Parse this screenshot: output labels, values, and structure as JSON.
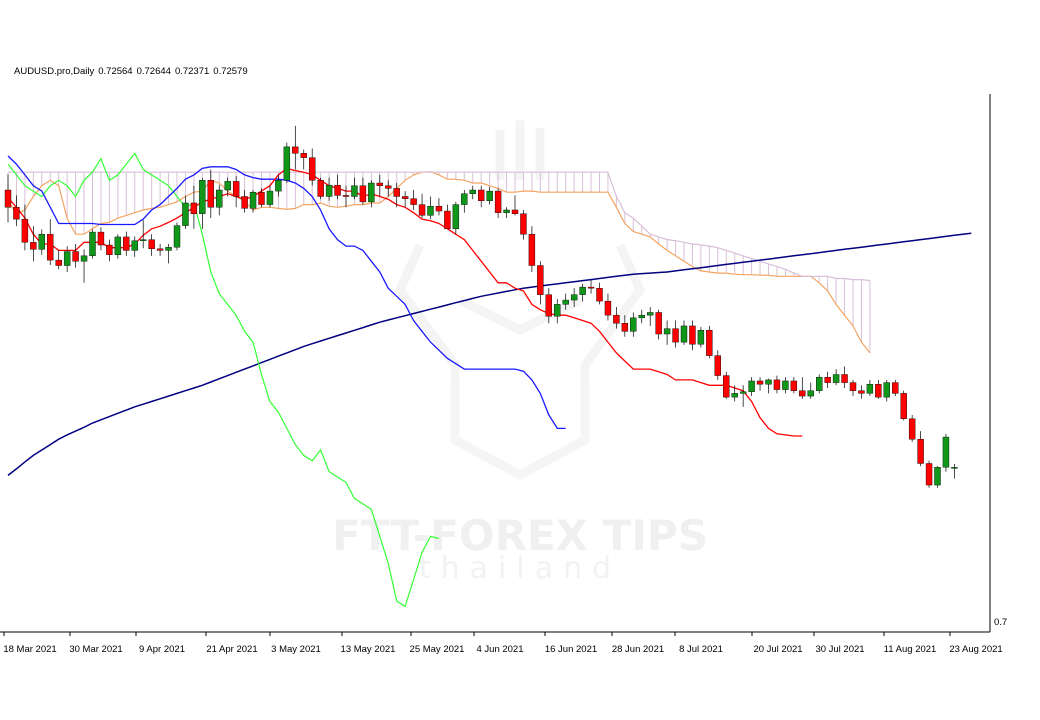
{
  "header": {
    "symbol": "AUDUSD.pro,Daily",
    "open": "0.72564",
    "high": "0.72644",
    "low": "0.72371",
    "close": "0.72579"
  },
  "watermark": {
    "line1": "FTT-FOREX TIPS",
    "line2": "thailand"
  },
  "price_label": "0.7",
  "colors": {
    "up": "#109618",
    "down": "#ff0000",
    "tenkan": "#ff0000",
    "kijun": "#1a1aff",
    "chikou": "#33ff33",
    "span_a": "#f4a460",
    "span_b": "#d8bfd8",
    "ma": "#000080"
  },
  "chart_data": {
    "type": "candlestick",
    "indicators": [
      "Ichimoku Kinko Hyo",
      "Moving Average"
    ],
    "x_ticks": [
      "18 Mar 2021",
      "30 Mar 2021",
      "9 Apr 2021",
      "21 Apr 2021",
      "3 May 2021",
      "13 May 2021",
      "25 May 2021",
      "4 Jun 2021",
      "16 Jun 2021",
      "28 Jun 2021",
      "8 Jul 2021",
      "20 Jul 2021",
      "30 Jul 2021",
      "11 Aug 2021",
      "23 Aug 2021"
    ],
    "y_range": [
      0.696,
      0.795
    ],
    "candles": [
      [
        0.7772,
        0.7801,
        0.7712,
        0.774
      ],
      [
        0.774,
        0.7762,
        0.7705,
        0.7718
      ],
      [
        0.7718,
        0.7745,
        0.766,
        0.7675
      ],
      [
        0.7675,
        0.7705,
        0.764,
        0.7662
      ],
      [
        0.7662,
        0.7699,
        0.7652,
        0.769
      ],
      [
        0.769,
        0.7718,
        0.7633,
        0.7642
      ],
      [
        0.7642,
        0.766,
        0.7625,
        0.7632
      ],
      [
        0.7632,
        0.7668,
        0.762,
        0.7658
      ],
      [
        0.7658,
        0.7672,
        0.7628,
        0.764
      ],
      [
        0.764,
        0.7662,
        0.76,
        0.765
      ],
      [
        0.765,
        0.7699,
        0.7645,
        0.7694
      ],
      [
        0.7694,
        0.7703,
        0.766,
        0.767
      ],
      [
        0.767,
        0.768,
        0.764,
        0.7652
      ],
      [
        0.7652,
        0.769,
        0.7645,
        0.7685
      ],
      [
        0.7685,
        0.7695,
        0.765,
        0.766
      ],
      [
        0.766,
        0.7686,
        0.7648,
        0.7678
      ],
      [
        0.7678,
        0.7716,
        0.7664,
        0.768
      ],
      [
        0.768,
        0.769,
        0.765,
        0.7663
      ],
      [
        0.7663,
        0.7672,
        0.765,
        0.766
      ],
      [
        0.766,
        0.7672,
        0.7636,
        0.7666
      ],
      [
        0.7666,
        0.7712,
        0.766,
        0.7706
      ],
      [
        0.7706,
        0.7761,
        0.77,
        0.7748
      ],
      [
        0.7748,
        0.778,
        0.77,
        0.7728
      ],
      [
        0.7728,
        0.7794,
        0.77,
        0.779
      ],
      [
        0.779,
        0.781,
        0.772,
        0.774
      ],
      [
        0.774,
        0.7782,
        0.7725,
        0.7772
      ],
      [
        0.7772,
        0.7795,
        0.776,
        0.7788
      ],
      [
        0.7788,
        0.7798,
        0.774,
        0.776
      ],
      [
        0.776,
        0.7772,
        0.773,
        0.7738
      ],
      [
        0.7738,
        0.7772,
        0.773,
        0.7768
      ],
      [
        0.7768,
        0.7775,
        0.774,
        0.7745
      ],
      [
        0.7745,
        0.778,
        0.774,
        0.777
      ],
      [
        0.777,
        0.78,
        0.776,
        0.779
      ],
      [
        0.779,
        0.786,
        0.7785,
        0.7852
      ],
      [
        0.7852,
        0.7891,
        0.781,
        0.784
      ],
      [
        0.784,
        0.7847,
        0.781,
        0.7832
      ],
      [
        0.7832,
        0.7849,
        0.778,
        0.779
      ],
      [
        0.779,
        0.7795,
        0.7755,
        0.776
      ],
      [
        0.776,
        0.7795,
        0.7752,
        0.7781
      ],
      [
        0.7781,
        0.78,
        0.7755,
        0.7762
      ],
      [
        0.7762,
        0.778,
        0.774,
        0.776
      ],
      [
        0.776,
        0.7795,
        0.7755,
        0.778
      ],
      [
        0.778,
        0.7795,
        0.7745,
        0.775
      ],
      [
        0.775,
        0.779,
        0.774,
        0.7785
      ],
      [
        0.7785,
        0.78,
        0.776,
        0.778
      ],
      [
        0.778,
        0.779,
        0.776,
        0.7775
      ],
      [
        0.7775,
        0.7785,
        0.774,
        0.776
      ],
      [
        0.776,
        0.777,
        0.774,
        0.7756
      ],
      [
        0.7756,
        0.7772,
        0.7735,
        0.7745
      ],
      [
        0.7745,
        0.7765,
        0.772,
        0.7725
      ],
      [
        0.7725,
        0.776,
        0.7718,
        0.7742
      ],
      [
        0.7742,
        0.7757,
        0.7725,
        0.7733
      ],
      [
        0.7733,
        0.7745,
        0.77,
        0.77
      ],
      [
        0.77,
        0.775,
        0.769,
        0.7745
      ],
      [
        0.7745,
        0.7772,
        0.773,
        0.7765
      ],
      [
        0.7765,
        0.778,
        0.7755,
        0.7772
      ],
      [
        0.7772,
        0.778,
        0.774,
        0.7752
      ],
      [
        0.7752,
        0.7778,
        0.7745,
        0.777
      ],
      [
        0.777,
        0.7775,
        0.772,
        0.773
      ],
      [
        0.773,
        0.774,
        0.772,
        0.7735
      ],
      [
        0.7735,
        0.7762,
        0.7725,
        0.7728
      ],
      [
        0.7728,
        0.7735,
        0.768,
        0.769
      ],
      [
        0.769,
        0.7705,
        0.762,
        0.7632
      ],
      [
        0.7632,
        0.764,
        0.756,
        0.7578
      ],
      [
        0.7578,
        0.759,
        0.7525,
        0.7538
      ],
      [
        0.7538,
        0.757,
        0.7525,
        0.756
      ],
      [
        0.756,
        0.758,
        0.755,
        0.7568
      ],
      [
        0.7568,
        0.759,
        0.7555,
        0.7578
      ],
      [
        0.7578,
        0.7598,
        0.7565,
        0.7592
      ],
      [
        0.7592,
        0.7605,
        0.758,
        0.759
      ],
      [
        0.759,
        0.76,
        0.756,
        0.7566
      ],
      [
        0.7566,
        0.758,
        0.753,
        0.754
      ],
      [
        0.754,
        0.7555,
        0.7515,
        0.7525
      ],
      [
        0.7525,
        0.754,
        0.75,
        0.751
      ],
      [
        0.751,
        0.7545,
        0.75,
        0.7535
      ],
      [
        0.7535,
        0.755,
        0.7525,
        0.754
      ],
      [
        0.754,
        0.7555,
        0.752,
        0.7545
      ],
      [
        0.7545,
        0.755,
        0.7495,
        0.7505
      ],
      [
        0.7505,
        0.753,
        0.7485,
        0.7515
      ],
      [
        0.7515,
        0.753,
        0.748,
        0.749
      ],
      [
        0.749,
        0.753,
        0.7485,
        0.752
      ],
      [
        0.752,
        0.753,
        0.7475,
        0.7486
      ],
      [
        0.7486,
        0.7518,
        0.748,
        0.7512
      ],
      [
        0.7512,
        0.752,
        0.746,
        0.7465
      ],
      [
        0.7465,
        0.7475,
        0.742,
        0.7428
      ],
      [
        0.7428,
        0.7435,
        0.7385,
        0.7388
      ],
      [
        0.7388,
        0.741,
        0.738,
        0.7395
      ],
      [
        0.7395,
        0.741,
        0.737,
        0.7398
      ],
      [
        0.7398,
        0.7425,
        0.739,
        0.7418
      ],
      [
        0.7418,
        0.7425,
        0.74,
        0.7412
      ],
      [
        0.7412,
        0.7422,
        0.7395,
        0.742
      ],
      [
        0.742,
        0.7428,
        0.7395,
        0.7402
      ],
      [
        0.7402,
        0.7425,
        0.7395,
        0.7418
      ],
      [
        0.7418,
        0.7425,
        0.7395,
        0.74
      ],
      [
        0.74,
        0.7425,
        0.7385,
        0.739
      ],
      [
        0.739,
        0.7415,
        0.7385,
        0.74
      ],
      [
        0.74,
        0.743,
        0.7395,
        0.7425
      ],
      [
        0.7425,
        0.7435,
        0.7405,
        0.7415
      ],
      [
        0.7415,
        0.744,
        0.741,
        0.743
      ],
      [
        0.743,
        0.7445,
        0.7405,
        0.7415
      ],
      [
        0.7415,
        0.742,
        0.739,
        0.74
      ],
      [
        0.74,
        0.741,
        0.7385,
        0.7395
      ],
      [
        0.7395,
        0.742,
        0.739,
        0.7412
      ],
      [
        0.7412,
        0.742,
        0.7385,
        0.7388
      ],
      [
        0.7388,
        0.742,
        0.738,
        0.7415
      ],
      [
        0.7415,
        0.742,
        0.739,
        0.7395
      ],
      [
        0.7395,
        0.74,
        0.7345,
        0.7348
      ],
      [
        0.7348,
        0.7355,
        0.7305,
        0.731
      ],
      [
        0.731,
        0.7325,
        0.726,
        0.7265
      ],
      [
        0.7265,
        0.727,
        0.722,
        0.7225
      ],
      [
        0.7225,
        0.726,
        0.722,
        0.7258
      ],
      [
        0.7258,
        0.732,
        0.725,
        0.7314
      ],
      [
        0.7256,
        0.7264,
        0.7237,
        0.7258
      ]
    ],
    "tenkan_sen": [
      0.7758,
      0.774,
      0.772,
      0.769,
      0.7672,
      0.7672,
      0.766,
      0.766,
      0.766,
      0.7675,
      0.7675,
      0.7675,
      0.7665,
      0.7665,
      0.7665,
      0.7672,
      0.7688,
      0.77,
      0.7705,
      0.7712,
      0.772,
      0.773,
      0.774,
      0.775,
      0.7755,
      0.776,
      0.7765,
      0.776,
      0.7755,
      0.776,
      0.777,
      0.778,
      0.78,
      0.7812,
      0.7808,
      0.7805,
      0.78,
      0.779,
      0.778,
      0.7775,
      0.777,
      0.777,
      0.776,
      0.7765,
      0.776,
      0.7755,
      0.7745,
      0.774,
      0.773,
      0.7718,
      0.7715,
      0.771,
      0.77,
      0.769,
      0.768,
      0.766,
      0.764,
      0.762,
      0.76,
      0.76,
      0.759,
      0.7585,
      0.756,
      0.755,
      0.7543,
      0.754,
      0.754,
      0.7535,
      0.753,
      0.7525,
      0.751,
      0.749,
      0.747,
      0.7455,
      0.744,
      0.744,
      0.744,
      0.7435,
      0.743,
      0.742,
      0.742,
      0.742,
      0.7415,
      0.741,
      0.741,
      0.741,
      0.7405,
      0.74,
      0.738,
      0.735,
      0.733,
      0.732,
      0.7318,
      0.7316,
      0.7316
    ],
    "kijun_sen": [
      0.7835,
      0.782,
      0.78,
      0.778,
      0.777,
      0.774,
      0.771,
      0.771,
      0.771,
      0.771,
      0.771,
      0.7708,
      0.7708,
      0.7708,
      0.7708,
      0.7708,
      0.7718,
      0.7735,
      0.7745,
      0.776,
      0.7775,
      0.7792,
      0.78,
      0.7812,
      0.7815,
      0.7815,
      0.7815,
      0.781,
      0.78,
      0.7795,
      0.7792,
      0.7792,
      0.7792,
      0.779,
      0.7785,
      0.7775,
      0.776,
      0.7735,
      0.77,
      0.768,
      0.7668,
      0.7668,
      0.766,
      0.764,
      0.762,
      0.759,
      0.7575,
      0.756,
      0.753,
      0.751,
      0.749,
      0.7475,
      0.746,
      0.745,
      0.744,
      0.744,
      0.744,
      0.744,
      0.744,
      0.744,
      0.744,
      0.7436,
      0.742,
      0.7395,
      0.7355,
      0.733,
      0.733
    ],
    "chikou_span": [
      0.782,
      0.78,
      0.778,
      0.777,
      0.776,
      0.778,
      0.779,
      0.778,
      0.776,
      0.779,
      0.7805,
      0.783,
      0.779,
      0.78,
      0.782,
      0.784,
      0.781,
      0.78,
      0.779,
      0.778,
      0.776,
      0.774,
      0.7748,
      0.769,
      0.762,
      0.758,
      0.756,
      0.754,
      0.751,
      0.749,
      0.743,
      0.738,
      0.736,
      0.733,
      0.73,
      0.728,
      0.727,
      0.729,
      0.725,
      0.724,
      0.723,
      0.72,
      0.719,
      0.718,
      0.713,
      0.708,
      0.701,
      0.7,
      0.705,
      0.71,
      0.713,
      0.7126
    ],
    "senkou_span_a": [
      0.7752,
      0.7728,
      0.7735,
      0.776,
      0.778,
      0.779,
      0.778,
      0.772,
      0.769,
      0.769,
      0.77,
      0.771,
      0.7712,
      0.772,
      0.7725,
      0.773,
      0.7735,
      0.7738,
      0.774,
      0.7745,
      0.775,
      0.776,
      0.7768,
      0.777,
      0.779,
      0.7785,
      0.777,
      0.776,
      0.7752,
      0.7735,
      0.774,
      0.774,
      0.7738,
      0.7736,
      0.7738,
      0.7745,
      0.7745,
      0.7748,
      0.7742,
      0.774,
      0.7742,
      0.7745,
      0.7745,
      0.7748,
      0.7748,
      0.776,
      0.7775,
      0.779,
      0.78,
      0.7805,
      0.7806,
      0.78,
      0.7792,
      0.7792,
      0.779,
      0.7785,
      0.7785,
      0.778,
      0.7775,
      0.7768,
      0.7768,
      0.777,
      0.777,
      0.7768,
      0.7768,
      0.7768,
      0.7768,
      0.7768,
      0.7768,
      0.7768,
      0.7768,
      0.7768,
      0.774,
      0.771,
      0.7695,
      0.769,
      0.7685,
      0.7672,
      0.766,
      0.765,
      0.764,
      0.763,
      0.7622,
      0.762,
      0.7618,
      0.7618,
      0.7616,
      0.7615,
      0.7615,
      0.7614,
      0.7614,
      0.7612,
      0.7612,
      0.7612,
      0.7612,
      0.7612,
      0.76,
      0.7585,
      0.756,
      0.754,
      0.752,
      0.749,
      0.747
    ],
    "senkou_span_b": [
      0.7805,
      0.7805,
      0.7805,
      0.7805,
      0.7805,
      0.7805,
      0.7805,
      0.7805,
      0.7805,
      0.7805,
      0.7805,
      0.7805,
      0.7805,
      0.7805,
      0.7805,
      0.7805,
      0.7805,
      0.7805,
      0.7805,
      0.7805,
      0.7805,
      0.7805,
      0.7805,
      0.7805,
      0.7805,
      0.7805,
      0.7805,
      0.7805,
      0.7805,
      0.7805,
      0.7805,
      0.7805,
      0.7805,
      0.7805,
      0.7805,
      0.7805,
      0.7805,
      0.7805,
      0.7805,
      0.7805,
      0.7805,
      0.7805,
      0.7805,
      0.7805,
      0.7805,
      0.7805,
      0.7805,
      0.7805,
      0.7805,
      0.7805,
      0.7805,
      0.7805,
      0.7805,
      0.7805,
      0.7805,
      0.7805,
      0.7805,
      0.7805,
      0.7805,
      0.7805,
      0.7805,
      0.7805,
      0.7805,
      0.7805,
      0.7805,
      0.7805,
      0.7805,
      0.7805,
      0.7805,
      0.7805,
      0.7805,
      0.7805,
      0.776,
      0.773,
      0.772,
      0.7705,
      0.769,
      0.7685,
      0.768,
      0.7678,
      0.7675,
      0.7672,
      0.767,
      0.7668,
      0.7665,
      0.766,
      0.7655,
      0.765,
      0.7645,
      0.764,
      0.7635,
      0.763,
      0.7625,
      0.7618,
      0.7612,
      0.7612,
      0.7612,
      0.7612,
      0.7608,
      0.7608,
      0.7606,
      0.7606,
      0.7604
    ],
    "moving_average": [
      0.7243,
      0.7255,
      0.7268,
      0.728,
      0.729,
      0.73,
      0.731,
      0.7318,
      0.7325,
      0.7332,
      0.734,
      0.7346,
      0.7352,
      0.7358,
      0.7364,
      0.737,
      0.7375,
      0.738,
      0.7385,
      0.739,
      0.7395,
      0.74,
      0.7405,
      0.741,
      0.7416,
      0.7422,
      0.7428,
      0.7434,
      0.744,
      0.7446,
      0.7452,
      0.7458,
      0.7464,
      0.747,
      0.7476,
      0.7482,
      0.7487,
      0.7492,
      0.7497,
      0.7502,
      0.7507,
      0.7512,
      0.7517,
      0.7522,
      0.7527,
      0.7531,
      0.7535,
      0.7539,
      0.7543,
      0.7547,
      0.7551,
      0.7555,
      0.7559,
      0.7563,
      0.7567,
      0.7571,
      0.7575,
      0.7578,
      0.7581,
      0.7584,
      0.7587,
      0.759,
      0.7592,
      0.7594,
      0.7596,
      0.7598,
      0.76,
      0.7602,
      0.7604,
      0.7606,
      0.7608,
      0.761,
      0.7612,
      0.7614,
      0.7616,
      0.7617,
      0.7618,
      0.7619,
      0.762,
      0.7622,
      0.7624,
      0.7626,
      0.7628,
      0.763,
      0.7632,
      0.7634,
      0.7636,
      0.7638,
      0.764,
      0.7642,
      0.7644,
      0.7646,
      0.7648,
      0.765,
      0.7652,
      0.7654,
      0.7656,
      0.7658,
      0.766,
      0.7662,
      0.7664,
      0.7666,
      0.7668,
      0.767,
      0.7672,
      0.7674,
      0.7676,
      0.7678,
      0.768,
      0.7682,
      0.7684,
      0.7686,
      0.7688,
      0.769,
      0.7692
    ]
  }
}
